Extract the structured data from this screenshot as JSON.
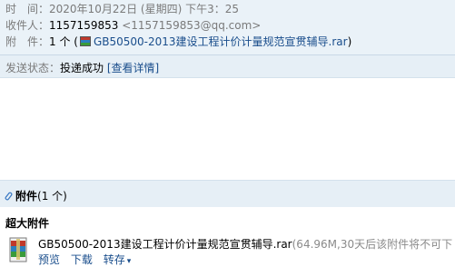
{
  "header": {
    "time_label": "时　间：",
    "time_value": "2020年10月22日 (星期四) 下午3：25",
    "recipient_label": "收件人：",
    "recipient_name": "1157159853",
    "recipient_email": "<1157159853@qq.com>",
    "attachment_label": "附　件：",
    "attachment_count": "1 个 (",
    "attachment_file": "GB50500-2013建设工程计价计量规范宣贯辅导.rar",
    "attachment_close": ")"
  },
  "status": {
    "label": "发送状态：",
    "value": "投递成功",
    "detail_link": "[查看详情]"
  },
  "attachments": {
    "bar_title": "附件",
    "bar_count": "(1 个)",
    "section_title": "超大附件",
    "file_name": "GB50500-2013建设工程计价计量规范宣贯辅导.rar",
    "file_meta": "(64.96M,30天后该附件将不可下",
    "actions": {
      "preview": "预览",
      "download": "下载",
      "save_to": "转存"
    }
  },
  "icons": {
    "rar": "rar-file-icon",
    "paperclip": "paperclip-icon",
    "file": "archive-file-icon",
    "caret": "chevron-down-icon"
  }
}
